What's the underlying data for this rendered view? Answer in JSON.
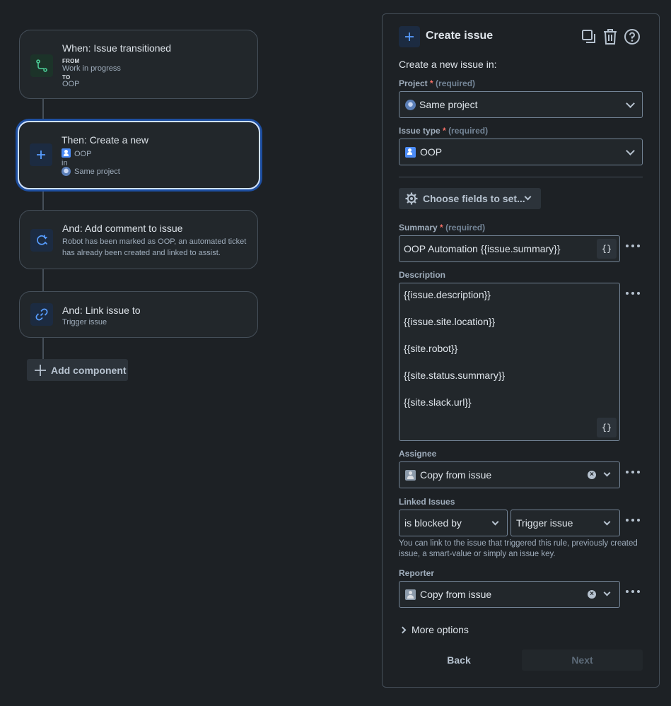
{
  "flow": {
    "trigger": {
      "title": "When: Issue transitioned",
      "from_label": "FROM",
      "from_value": "Work in progress",
      "to_label": "TO",
      "to_value": "OOP"
    },
    "action": {
      "title": "Then: Create a new",
      "issue_type": "OOP",
      "in_label": "in",
      "project": "Same project"
    },
    "comment": {
      "title": "And: Add comment to issue",
      "line1": "Robot has been marked as OOP, an automated ticket",
      "line2": "has already been created and linked to assist."
    },
    "link": {
      "title": "And: Link issue to",
      "subtitle": "Trigger issue"
    },
    "add_component_label": "Add component"
  },
  "panel": {
    "title": "Create issue",
    "intro": "Create a new issue in:",
    "project": {
      "label": "Project",
      "required_mark": "*",
      "hint": "(required)",
      "value": "Same project"
    },
    "issue_type": {
      "label": "Issue type",
      "required_mark": "*",
      "hint": "(required)",
      "value": "OOP"
    },
    "choose_fields_label": "Choose fields to set...",
    "summary": {
      "label": "Summary",
      "required_mark": "*",
      "hint": "(required)",
      "value": "OOP Automation {{issue.summary}}"
    },
    "curly_label": "{}",
    "description": {
      "label": "Description",
      "lines": [
        "{{issue.description}}",
        "{{issue.site.location}}",
        "{{site.robot}}",
        "{{site.status.summary}}",
        "{{site.slack.url}}"
      ]
    },
    "assignee": {
      "label": "Assignee",
      "value": "Copy from issue"
    },
    "linked_issues": {
      "label": "Linked Issues",
      "relation": "is blocked by",
      "target": "Trigger issue",
      "help_line1": "You can link to the issue that triggered this rule, previously created",
      "help_line2": "issue, a smart-value or simply an issue key."
    },
    "reporter": {
      "label": "Reporter",
      "value": "Copy from issue"
    },
    "more_options_label": "More options",
    "back_label": "Back",
    "next_label": "Next"
  },
  "colors": {
    "background": "#1d2125",
    "card": "#22272b",
    "selected_border": "#cfe1fd",
    "accent_blue": "#579dff",
    "trigger_green": "#4bce97",
    "required_red": "#f87168"
  }
}
